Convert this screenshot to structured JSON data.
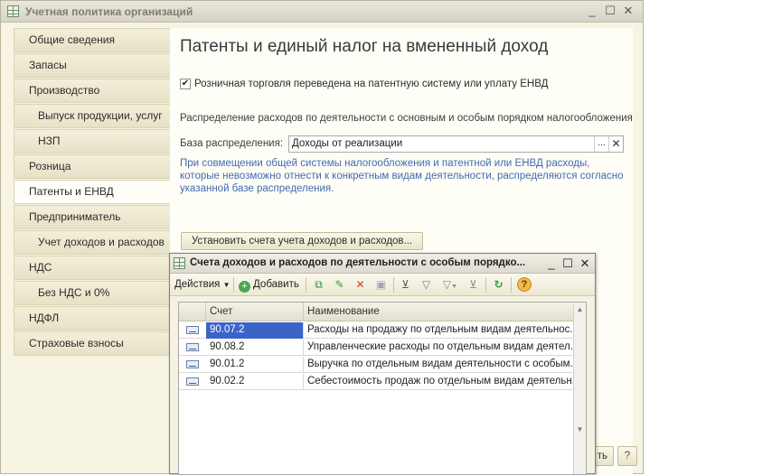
{
  "window": {
    "title": "Учетная политика организаций"
  },
  "sidebar": {
    "items": [
      {
        "label": "Общие сведения"
      },
      {
        "label": "Запасы"
      },
      {
        "label": "Производство"
      },
      {
        "label": "Выпуск продукции, услуг"
      },
      {
        "label": "НЗП"
      },
      {
        "label": "Розница"
      },
      {
        "label": "Патенты и ЕНВД"
      },
      {
        "label": "Предприниматель"
      },
      {
        "label": "Учет доходов и расходов"
      },
      {
        "label": "НДС"
      },
      {
        "label": "Без НДС и 0%"
      },
      {
        "label": "НДФЛ"
      },
      {
        "label": "Страховые взносы"
      }
    ],
    "active_index": 6
  },
  "content": {
    "title": "Патенты и единый налог на вмененный доход",
    "checkbox_label": "Розничная торговля переведена на патентную систему или уплату ЕНВД",
    "checkbox_checked": true,
    "section_label": "Распределение расходов по деятельности с основным и особым порядком налогообложения",
    "base_label": "База распределения:",
    "base_value": "Доходы от реализации",
    "hint": "При совмещении общей системы налогообложения и патентной или ЕНВД расходы, которые невозможно отнести к конкретным видам деятельности, распределяются согласно указанной базе распределения.",
    "set_accounts_button": "Установить счета учета доходов и расходов...",
    "bottom_button_partial": "ть",
    "help_glyph": "?"
  },
  "dialog": {
    "title": "Счета доходов и расходов по деятельности с особым порядко...",
    "toolbar": {
      "actions_label": "Действия",
      "add_label": "Добавить"
    },
    "columns": [
      "Счет",
      "Наименование"
    ],
    "rows": [
      {
        "account": "90.07.2",
        "name": "Расходы на продажу по отдельным видам деятельнос..."
      },
      {
        "account": "90.08.2",
        "name": "Управленческие расходы по отдельным видам деятел..."
      },
      {
        "account": "90.01.2",
        "name": "Выручка по отдельным видам деятельности с особым..."
      },
      {
        "account": "90.02.2",
        "name": "Себестоимость продаж по отдельным видам деятельн..."
      }
    ],
    "selected_row": 0
  },
  "colors": {
    "window_bg": "#f7f4e4",
    "hint_text": "#4269b0",
    "selection": "#3c64c8"
  },
  "icons": {
    "dialog_toolbar": [
      "add-copy-icon",
      "edit-pencil-icon",
      "delete-x-icon",
      "save-disk-icon",
      "filter-icon",
      "filter-settings-icon",
      "filter-dropdown-icon",
      "clear-filter-icon",
      "refresh-icon",
      "help-icon"
    ]
  }
}
